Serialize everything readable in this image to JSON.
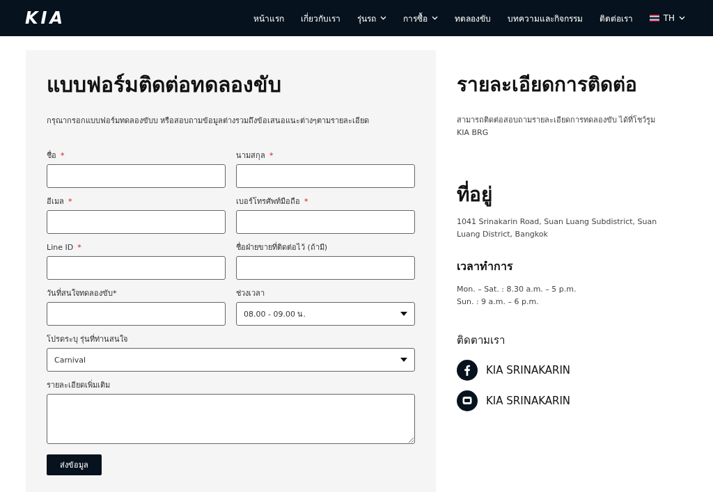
{
  "header": {
    "logo": "KIA",
    "nav": [
      {
        "label": "หน้าแรก",
        "has_menu": false
      },
      {
        "label": "เกี่ยวกับเรา",
        "has_menu": false
      },
      {
        "label": "รุ่นรถ",
        "has_menu": true
      },
      {
        "label": "การซื้อ",
        "has_menu": true
      },
      {
        "label": "ทดลองขับ",
        "has_menu": false
      },
      {
        "label": "บทความและกิจกรรม",
        "has_menu": false
      },
      {
        "label": "ติดต่อเรา",
        "has_menu": false
      }
    ],
    "language": {
      "label": "TH",
      "has_menu": true
    }
  },
  "form": {
    "title": "แบบฟอร์มติดต่อทดลองขับ",
    "intro": "กรุณากรอกแบบฟอร์มทดลองขับบ หรือสอบถามข้อมูลต่างรวมถึงข้อเสนอแนะต่างๆตามรายละเอียด",
    "fields": [
      {
        "kind": "text",
        "label": "ชื่อ",
        "required_mark": "*",
        "wide": false
      },
      {
        "kind": "text",
        "label": "นามสกุล",
        "required_mark": "*",
        "wide": false
      },
      {
        "kind": "text",
        "label": "อีเมล",
        "required_mark": "*",
        "wide": false
      },
      {
        "kind": "text",
        "label": "เบอร์โทรศัพท์มือถือ",
        "required_mark": "*",
        "wide": false
      },
      {
        "kind": "text",
        "label": "Line ID",
        "required_mark": "*",
        "wide": false
      },
      {
        "kind": "text",
        "label": "ชื่อฝ่ายขายที่ติดต่อไว้ (ถ้ามี)",
        "wide": false
      },
      {
        "kind": "text",
        "label": "วันที่สนใจทดลองขับ*",
        "wide": false
      },
      {
        "kind": "select",
        "label": "ช่วงเวลา",
        "wide": false,
        "value": "08.00 - 09.00 น."
      },
      {
        "kind": "select",
        "label": "โปรดระบุ รุ่นที่ท่านสนใจ",
        "wide": true,
        "value": "Carnival"
      },
      {
        "kind": "textarea",
        "label": "รายละเอียดเพิ่มเติม",
        "wide": true
      }
    ],
    "submit": "ส่งข้อมูล"
  },
  "contact": {
    "title": "รายละเอียดการติดต่อ",
    "intro": "สามารถติดต่อสอบถามรายละเอียดการทดลองขับ ได้ที่โชว์รูม KIA BRG",
    "address_title": "ที่อยู่",
    "address": "1041 Srinakarin Road, Suan Luang Subdistrict, Suan Luang District, Bangkok",
    "hours_title": "เวลาทำการ",
    "hours": [
      "Mon. – Sat. : 8.30 a.m. – 5 p.m.",
      "Sun. : 9 a.m. – 6 p.m."
    ],
    "follow_title": "ติดตามเรา",
    "socials": [
      {
        "kind": "facebook",
        "label": "KIA SRINAKARIN"
      },
      {
        "kind": "line",
        "label": "KIA SRINAKARIN"
      }
    ]
  }
}
